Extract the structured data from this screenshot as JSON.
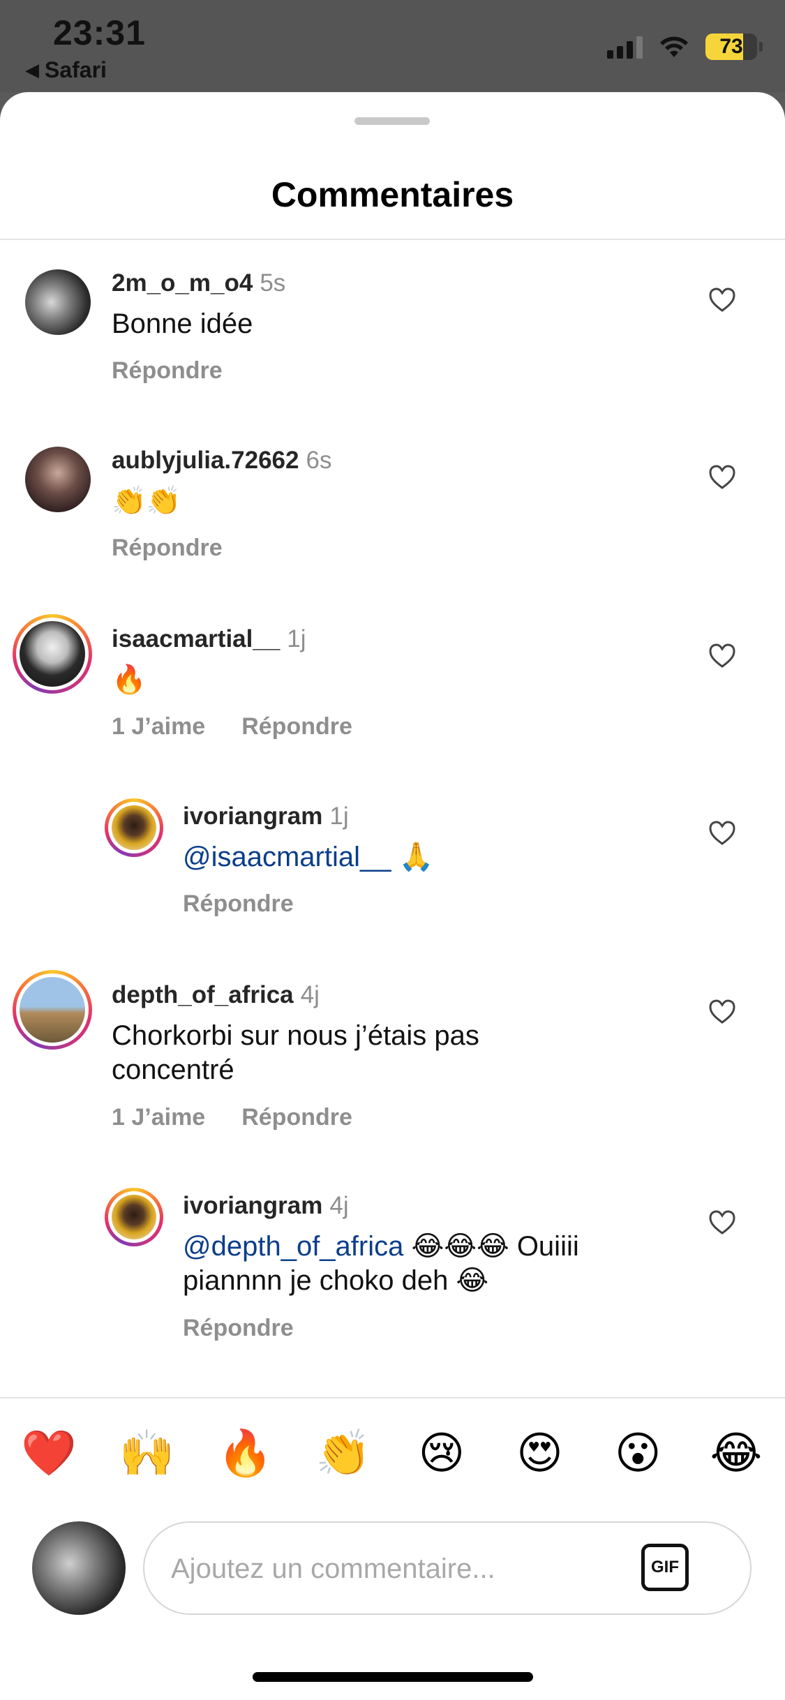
{
  "status_bar": {
    "time": "23:31",
    "back_app": "Safari",
    "battery_level": "73",
    "battery_fraction": 0.73
  },
  "sheet": {
    "title": "Commentaires"
  },
  "comments": [
    {
      "user": "2m_o_m_o4",
      "time": "5s",
      "text": "Bonne idée",
      "mention": "",
      "likes": "",
      "reply": "Répondre",
      "avatar_color": "#3b3b3b"
    },
    {
      "user": "aublyjulia.72662",
      "time": "6s",
      "text": "👏👏",
      "mention": "",
      "likes": "",
      "reply": "Répondre",
      "avatar_color": "#4a3a3a"
    },
    {
      "user": "isaacmartial__",
      "time": "1j",
      "text": "🔥",
      "mention": "",
      "likes": "1 J’aime",
      "reply": "Répondre",
      "avatar_color": "#2d2d2d"
    },
    {
      "user": "ivoriangram",
      "time": "1j",
      "text": " 🙏",
      "mention": "@isaacmartial__",
      "likes": "",
      "reply": "Répondre",
      "avatar_color": "#d9a520"
    },
    {
      "user": "depth_of_africa",
      "time": "4j",
      "text": "Chorkorbi sur nous j’étais pas concentré",
      "mention": "",
      "likes": "1 J’aime",
      "reply": "Répondre",
      "avatar_color": "#6b8fb5"
    },
    {
      "user": "ivoriangram",
      "time": "4j",
      "text": " 😂😂😂 Ouiiii piannnn je choko deh 😂",
      "mention": "@depth_of_africa",
      "likes": "",
      "reply": "Répondre",
      "avatar_color": "#d9a520"
    }
  ],
  "emoji_bar": [
    "❤️",
    "🙌",
    "🔥",
    "👏",
    "😢",
    "😍",
    "😮",
    "😂"
  ],
  "composer": {
    "placeholder": "Ajoutez un commentaire...",
    "gif_label": "GIF"
  },
  "icons": {
    "heart": "heart-icon",
    "gif": "gif-icon",
    "back": "back-arrow-icon"
  },
  "colors": {
    "mention": "#0b3e8a",
    "battery": "#f6d53a"
  }
}
